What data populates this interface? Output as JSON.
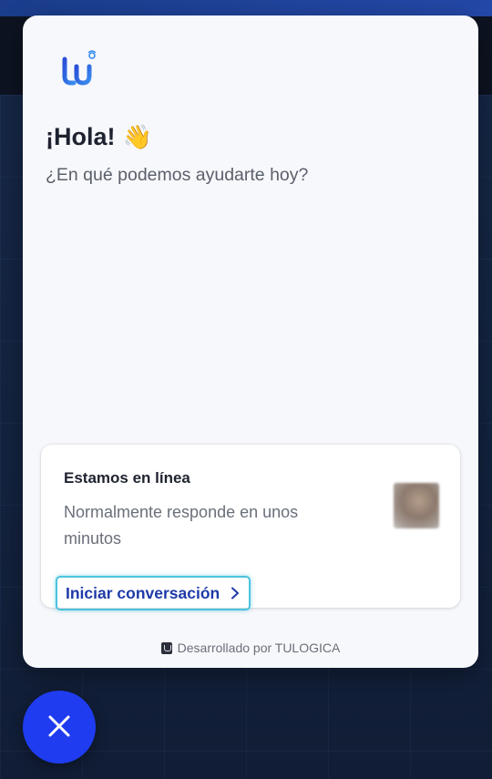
{
  "widget": {
    "greeting": "¡Hola!",
    "greeting_emoji": "👋",
    "subtitle": "¿En qué podemos ayudarte hoy?",
    "logo_icon": "tulogica-logo-icon",
    "status_card": {
      "title": "Estamos en línea",
      "description": "Normalmente responde en unos minutos",
      "start_button_label": "Iniciar conversación",
      "start_button_icon": "chevron-right-icon"
    },
    "footer": "Desarrollado por TULOGICA"
  },
  "close_button": {
    "icon": "close-icon"
  },
  "colors": {
    "accent_blue": "#1f3cf0",
    "link_blue": "#1e3aa8",
    "focus_ring": "#4cc3dd",
    "panel_bg": "#f7f8fb",
    "page_bg": "#14233f"
  }
}
